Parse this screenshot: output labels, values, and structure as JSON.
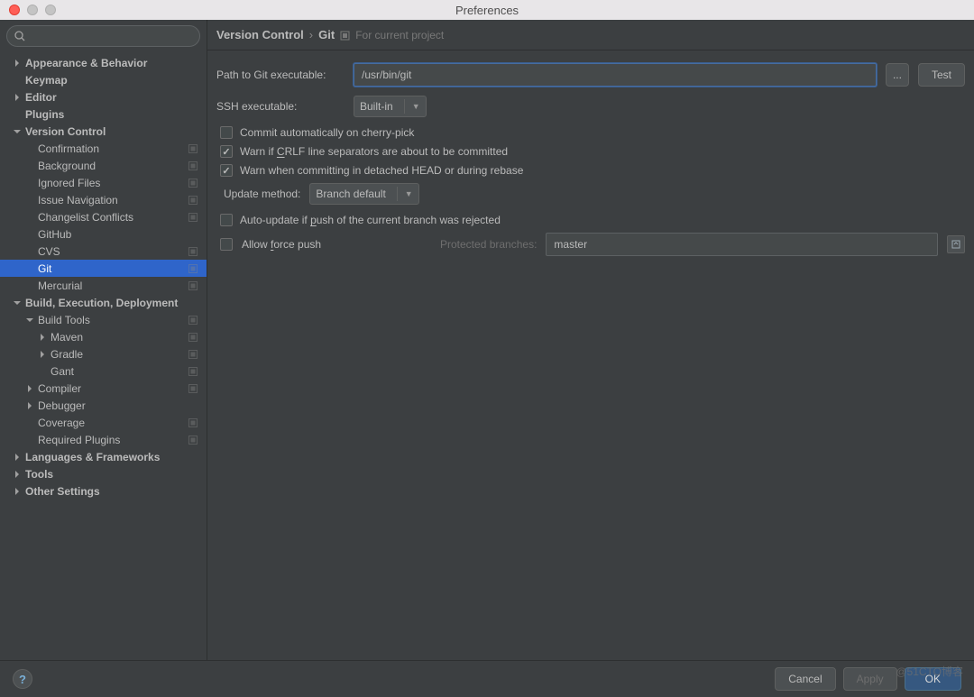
{
  "window": {
    "title": "Preferences"
  },
  "breadcrumb": {
    "part1": "Version Control",
    "part2": "Git",
    "hint": "For current project"
  },
  "sidebar": {
    "items": [
      {
        "label": "Appearance & Behavior",
        "depth": 0,
        "arrow": "right",
        "bold": true,
        "badge": false
      },
      {
        "label": "Keymap",
        "depth": 0,
        "arrow": "none",
        "bold": true,
        "badge": false
      },
      {
        "label": "Editor",
        "depth": 0,
        "arrow": "right",
        "bold": true,
        "badge": false
      },
      {
        "label": "Plugins",
        "depth": 0,
        "arrow": "none",
        "bold": true,
        "badge": false
      },
      {
        "label": "Version Control",
        "depth": 0,
        "arrow": "down",
        "bold": true,
        "badge": false
      },
      {
        "label": "Confirmation",
        "depth": 1,
        "arrow": "none",
        "bold": false,
        "badge": true
      },
      {
        "label": "Background",
        "depth": 1,
        "arrow": "none",
        "bold": false,
        "badge": true
      },
      {
        "label": "Ignored Files",
        "depth": 1,
        "arrow": "none",
        "bold": false,
        "badge": true
      },
      {
        "label": "Issue Navigation",
        "depth": 1,
        "arrow": "none",
        "bold": false,
        "badge": true
      },
      {
        "label": "Changelist Conflicts",
        "depth": 1,
        "arrow": "none",
        "bold": false,
        "badge": true
      },
      {
        "label": "GitHub",
        "depth": 1,
        "arrow": "none",
        "bold": false,
        "badge": false
      },
      {
        "label": "CVS",
        "depth": 1,
        "arrow": "none",
        "bold": false,
        "badge": true
      },
      {
        "label": "Git",
        "depth": 1,
        "arrow": "none",
        "bold": false,
        "badge": true,
        "selected": true
      },
      {
        "label": "Mercurial",
        "depth": 1,
        "arrow": "none",
        "bold": false,
        "badge": true
      },
      {
        "label": "Build, Execution, Deployment",
        "depth": 0,
        "arrow": "down",
        "bold": true,
        "badge": false
      },
      {
        "label": "Build Tools",
        "depth": 1,
        "arrow": "down",
        "bold": false,
        "badge": true
      },
      {
        "label": "Maven",
        "depth": 2,
        "arrow": "right",
        "bold": false,
        "badge": true
      },
      {
        "label": "Gradle",
        "depth": 2,
        "arrow": "right",
        "bold": false,
        "badge": true
      },
      {
        "label": "Gant",
        "depth": 2,
        "arrow": "none",
        "bold": false,
        "badge": true
      },
      {
        "label": "Compiler",
        "depth": 1,
        "arrow": "right",
        "bold": false,
        "badge": true
      },
      {
        "label": "Debugger",
        "depth": 1,
        "arrow": "right",
        "bold": false,
        "badge": false
      },
      {
        "label": "Coverage",
        "depth": 1,
        "arrow": "none",
        "bold": false,
        "badge": true
      },
      {
        "label": "Required Plugins",
        "depth": 1,
        "arrow": "none",
        "bold": false,
        "badge": true
      },
      {
        "label": "Languages & Frameworks",
        "depth": 0,
        "arrow": "right",
        "bold": true,
        "badge": false
      },
      {
        "label": "Tools",
        "depth": 0,
        "arrow": "right",
        "bold": true,
        "badge": false
      },
      {
        "label": "Other Settings",
        "depth": 0,
        "arrow": "right",
        "bold": true,
        "badge": false
      }
    ]
  },
  "form": {
    "path_label": "Path to Git executable:",
    "path_value": "/usr/bin/git",
    "browse_btn": "...",
    "test_btn": "Test",
    "ssh_label": "SSH executable:",
    "ssh_value": "Built-in",
    "cb1": {
      "pre": "Commit automatically on cherry-pick",
      "checked": false
    },
    "cb2": {
      "pre": "Warn if ",
      "u": "C",
      "post": "RLF line separators are about to be committed",
      "checked": true
    },
    "cb3": {
      "pre": "Warn when committing in detached HEAD or during rebase",
      "checked": true
    },
    "update_label": "Update method:",
    "update_value": "Branch default",
    "cb4": {
      "pre": "Auto-update if ",
      "u": "p",
      "post": "ush of the current branch was rejected",
      "checked": false
    },
    "cb5": {
      "pre": "Allow ",
      "u": "f",
      "post": "orce push",
      "checked": false
    },
    "protected_label": "Protected branches:",
    "protected_value": "master"
  },
  "footer": {
    "cancel": "Cancel",
    "apply": "Apply",
    "ok": "OK",
    "help": "?"
  },
  "watermark": "@51CTO博客"
}
